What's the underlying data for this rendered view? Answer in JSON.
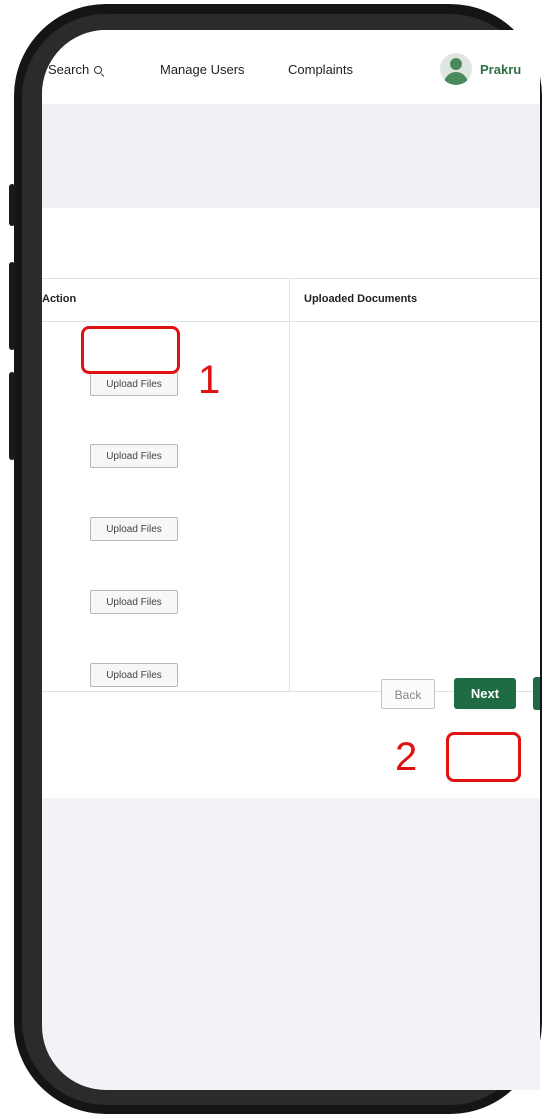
{
  "nav": {
    "search_label": "Search",
    "manage_users_label": "Manage Users",
    "complaints_label": "Complaints",
    "user_name": "Prakru",
    "avatar_icon": "user-avatar-icon"
  },
  "table": {
    "col_action": "Action",
    "col_uploaded_documents": "Uploaded Documents",
    "rows": [
      {
        "upload_label": "Upload Files"
      },
      {
        "upload_label": "Upload Files"
      },
      {
        "upload_label": "Upload Files"
      },
      {
        "upload_label": "Upload Files"
      },
      {
        "upload_label": "Upload Files"
      }
    ]
  },
  "footer": {
    "back_label": "Back",
    "next_label": "Next"
  },
  "annotations": {
    "step1": "1",
    "step2": "2"
  },
  "colors": {
    "primary_green": "#1f6b44",
    "highlight_red": "#e01212"
  }
}
